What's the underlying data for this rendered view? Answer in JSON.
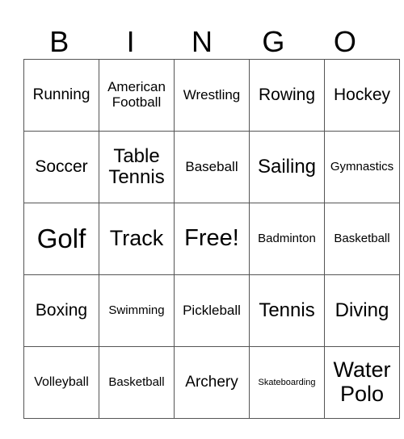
{
  "header": [
    "B",
    "I",
    "N",
    "G",
    "O"
  ],
  "cells": [
    [
      {
        "text": "Running",
        "size": "s19"
      },
      {
        "text": "American Football",
        "size": "s17"
      },
      {
        "text": "Wrestling",
        "size": "s17"
      },
      {
        "text": "Rowing",
        "size": "s21"
      },
      {
        "text": "Hockey",
        "size": "s21"
      }
    ],
    [
      {
        "text": "Soccer",
        "size": "s21"
      },
      {
        "text": "Table Tennis",
        "size": "s24"
      },
      {
        "text": "Baseball",
        "size": "s17"
      },
      {
        "text": "Sailing",
        "size": "s24"
      },
      {
        "text": "Gymnastics",
        "size": "s15"
      }
    ],
    [
      {
        "text": "Golf",
        "size": "s33"
      },
      {
        "text": "Track",
        "size": "s27"
      },
      {
        "text": "Free!",
        "size": "s29"
      },
      {
        "text": "Badminton",
        "size": "s15"
      },
      {
        "text": "Basketball",
        "size": "s15"
      }
    ],
    [
      {
        "text": "Boxing",
        "size": "s21"
      },
      {
        "text": "Swimming",
        "size": "s15"
      },
      {
        "text": "Pickleball",
        "size": "s17"
      },
      {
        "text": "Tennis",
        "size": "s24"
      },
      {
        "text": "Diving",
        "size": "s24"
      }
    ],
    [
      {
        "text": "Volleyball",
        "size": "s16"
      },
      {
        "text": "Basketball",
        "size": "s15"
      },
      {
        "text": "Archery",
        "size": "s19"
      },
      {
        "text": "Skateboarding",
        "size": "s11"
      },
      {
        "text": "Water Polo",
        "size": "s27"
      }
    ]
  ]
}
